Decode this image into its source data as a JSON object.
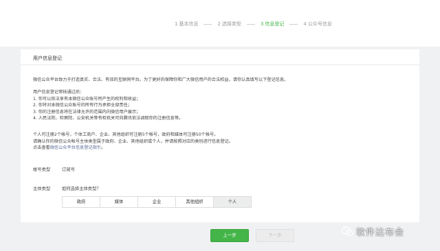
{
  "steps": [
    {
      "number": "1",
      "label": "基本信息",
      "active": false
    },
    {
      "number": "2",
      "label": "选择类型",
      "active": false
    },
    {
      "number": "3",
      "label": "信息登记",
      "active": true
    },
    {
      "number": "4",
      "label": "公众号信息",
      "active": false
    }
  ],
  "card": {
    "title": "用户信息登记",
    "intro": "微信公众平台致力于打造真实、合法、有效的互联网平台。为了更好的保障你和广大微信用户的合法权益，请你认真填写以下登记信息。",
    "rules_title": "用户信息登记审核通过后：",
    "rules": [
      "1. 你可以依法享有本微信公众账号所产生的权利和收益；",
      "2. 你将对本微信公众账号的所有行为承担全部责任；",
      "3. 你的注册信息将在法律允许的范围内向微信用户展示；",
      "4. 人民法院、检察院、公安机关等有权机关可向腾讯依法调取你的注册信息等。"
    ],
    "notes": [
      "个人可注册2个帐号，个体工商户、企业、其他组织可注册5个帐号，政府和媒体可注册50个帐号。",
      "请确认你的微信公众帐号主体类型属于政府、企业、其他组织或个人，并请按照对应的类别进行信息登记。"
    ],
    "guide_prefix": "点击查看",
    "guide_link": "微信公众平台信息登记指引",
    "guide_suffix": "。",
    "account_type_label": "帐号类型",
    "account_type_value": "订阅号",
    "entity_type_label": "主体类型",
    "entity_type_help": "如何选择主体类型？",
    "entity_options": [
      "政府",
      "媒体",
      "企业",
      "其他组织",
      "个人"
    ],
    "entity_selected": "个人"
  },
  "buttons": {
    "prev": "上一步",
    "next": "下一步"
  },
  "watermark": {
    "text": "软件达布会"
  },
  "colors": {
    "accent_green": "#44b549",
    "link_blue": "#576b95",
    "background": "#f0f1f3"
  }
}
